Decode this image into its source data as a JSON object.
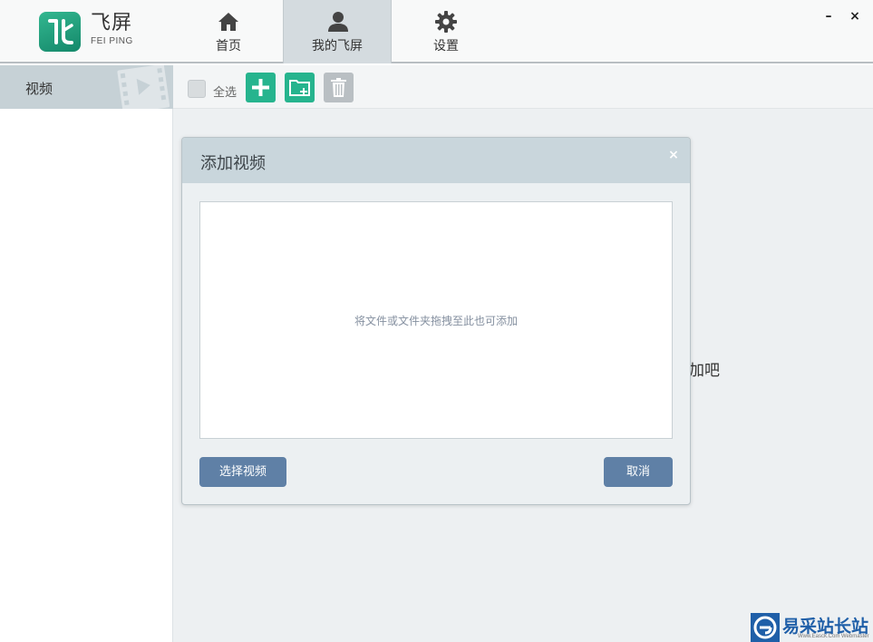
{
  "app": {
    "brand_cn": "飞屏",
    "brand_en": "FEI PING"
  },
  "nav": {
    "tabs": [
      {
        "label": "首页",
        "icon": "home-icon"
      },
      {
        "label": "我的飞屏",
        "icon": "user-icon",
        "active": true
      },
      {
        "label": "设置",
        "icon": "gear-icon"
      }
    ]
  },
  "window": {
    "minimize": "–",
    "close": "×"
  },
  "sidebar": {
    "items": [
      {
        "label": "视频",
        "icon": "film-play-icon"
      }
    ]
  },
  "toolbar": {
    "select_all_label": "全选",
    "add_icon": "plus-icon",
    "folder_icon": "folder-add-icon",
    "delete_icon": "trash-icon"
  },
  "main": {
    "empty_hint_visible": "加吧"
  },
  "dialog": {
    "title": "添加视频",
    "close": "×",
    "drop_hint": "将文件或文件夹拖拽至此也可添加",
    "choose_button": "选择视频",
    "cancel_button": "取消"
  },
  "watermark": {
    "text": "易采站长站",
    "sub": "Www.Easck.Com  Webmaster"
  },
  "colors": {
    "accent_green": "#26b48e",
    "button_blue": "#5f80a6",
    "sidebar_active": "#c6d1d6",
    "dialog_header": "#c9d6dc"
  }
}
